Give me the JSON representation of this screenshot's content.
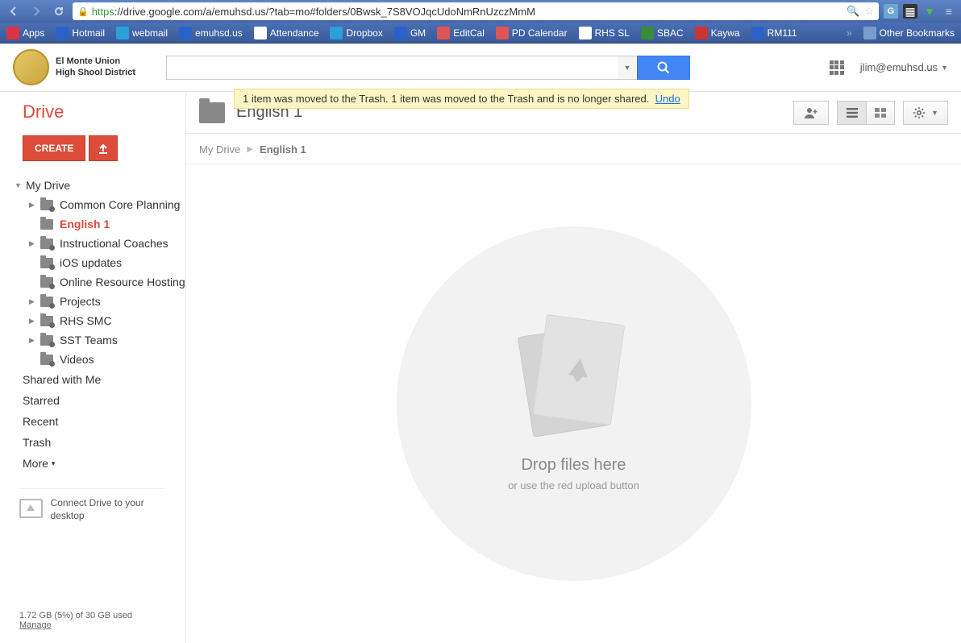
{
  "browser": {
    "url_https": "https",
    "url_rest": "://drive.google.com/a/emuhsd.us/?tab=mo#folders/0Bwsk_7S8VOJqcUdoNmRnUzczMmM"
  },
  "bookmarks": [
    {
      "label": "Apps",
      "color": "#d34"
    },
    {
      "label": "Hotmail",
      "color": "#2a62c9"
    },
    {
      "label": "webmail",
      "color": "#2aa0d6"
    },
    {
      "label": "emuhsd.us",
      "color": "#2a62c9"
    },
    {
      "label": "Attendance",
      "color": "#fff"
    },
    {
      "label": "Dropbox",
      "color": "#2aa0d6"
    },
    {
      "label": "GM",
      "color": "#2a62c9"
    },
    {
      "label": "EditCal",
      "color": "#d55"
    },
    {
      "label": "PD Calendar",
      "color": "#d55"
    },
    {
      "label": "RHS SL",
      "color": "#fff"
    },
    {
      "label": "SBAC",
      "color": "#3a8c3a"
    },
    {
      "label": "Kaywa",
      "color": "#c33"
    },
    {
      "label": "RM111",
      "color": "#2a62c9"
    }
  ],
  "other_bookmarks": "Other Bookmarks",
  "district": {
    "line1": "El Monte Union",
    "line2": "High Shool District"
  },
  "user": {
    "email": "jlim@emuhsd.us"
  },
  "notification": {
    "text": "1 item was moved to the Trash. 1 item was moved to the Trash and is no longer shared.",
    "undo": "Undo"
  },
  "drive_label": "Drive",
  "create_label": "CREATE",
  "tree": {
    "root": "My Drive",
    "items": [
      {
        "label": "Common Core Planning",
        "shared": true,
        "expandable": true
      },
      {
        "label": "English 1",
        "shared": false,
        "expandable": false,
        "active": true
      },
      {
        "label": "Instructional Coaches",
        "shared": true,
        "expandable": true
      },
      {
        "label": "iOS updates",
        "shared": true,
        "expandable": false
      },
      {
        "label": "Online Resource Hosting",
        "shared": true,
        "expandable": false
      },
      {
        "label": "Projects",
        "shared": true,
        "expandable": true
      },
      {
        "label": "RHS SMC",
        "shared": true,
        "expandable": true
      },
      {
        "label": "SST Teams",
        "shared": true,
        "expandable": true
      },
      {
        "label": "Videos",
        "shared": true,
        "expandable": false
      }
    ]
  },
  "links": {
    "shared": "Shared with Me",
    "starred": "Starred",
    "recent": "Recent",
    "trash": "Trash",
    "more": "More"
  },
  "connect": "Connect Drive to your desktop",
  "storage": {
    "line": "1.72 GB (5%) of 30 GB used",
    "manage": "Manage"
  },
  "titlebar": {
    "folder": "English 1"
  },
  "breadcrumb": {
    "root": "My Drive",
    "current": "English 1"
  },
  "empty": {
    "title": "Drop files here",
    "sub": "or use the red upload button"
  }
}
